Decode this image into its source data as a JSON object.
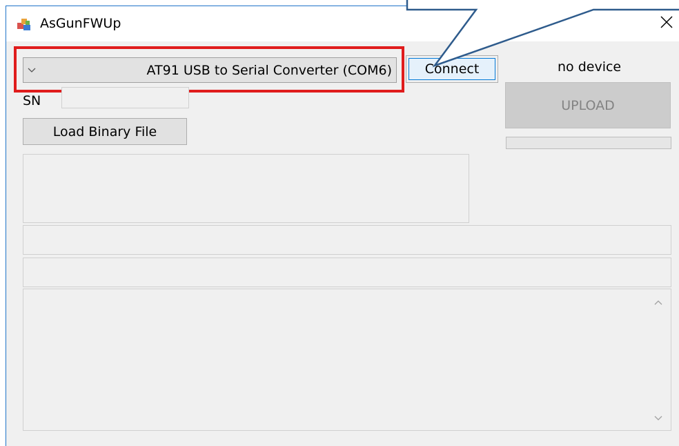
{
  "window": {
    "title": "AsGunFWUp",
    "app_icon": "app-icon",
    "close_icon": "close-icon"
  },
  "port_selector": {
    "value": "AT91 USB to Serial Converter (COM6)",
    "chevron_icon": "chevron-down-icon"
  },
  "buttons": {
    "connect": "Connect",
    "upload": "UPLOAD",
    "load_binary": "Load Binary File"
  },
  "status": {
    "device": "no device"
  },
  "serial": {
    "label": "SN",
    "value": ""
  },
  "progress": {
    "value": 0
  },
  "log": {
    "scroll_up_icon": "scroll-up-icon",
    "scroll_down_icon": "scroll-down-icon"
  },
  "colors": {
    "highlight": "#e01c1c",
    "callout": "#2e5b8c",
    "connect_border": "#0078d7"
  }
}
